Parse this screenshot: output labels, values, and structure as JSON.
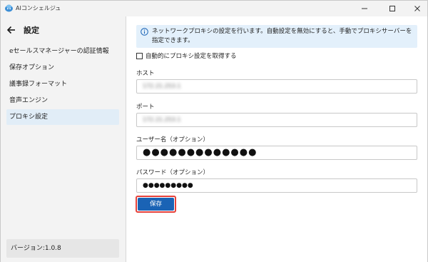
{
  "window": {
    "title": "AIコンシェルジュ"
  },
  "sidebar": {
    "title": "設定",
    "items": [
      {
        "label": "eセールスマネージャーの認証情報",
        "active": false
      },
      {
        "label": "保存オプション",
        "active": false
      },
      {
        "label": "議事録フォーマット",
        "active": false
      },
      {
        "label": "音声エンジン",
        "active": false
      },
      {
        "label": "プロキシ設定",
        "active": true
      }
    ],
    "version": "バージョン:1.0.8"
  },
  "main": {
    "info": "ネットワークプロキシの設定を行います。自動設定を無効にすると、手動でプロキシサーバーを指定できます。",
    "auto_checkbox": {
      "label": "自動的にプロキシ設定を取得する",
      "checked": false
    },
    "host": {
      "label": "ホスト",
      "value": "172.21.253.1"
    },
    "port": {
      "label": "ポート",
      "value": "172.21.253.1"
    },
    "username": {
      "label": "ユーザー名（オプション）",
      "value": "●●●●●●●●●●●●●"
    },
    "password": {
      "label": "パスワード（オプション）",
      "value": "●●●●●●●●●"
    },
    "save_label": "保存"
  },
  "colors": {
    "accent": "#1a63b5",
    "highlight": "#e5413a",
    "info_bg": "#e3f0fb",
    "active_nav": "#e1edf7"
  }
}
